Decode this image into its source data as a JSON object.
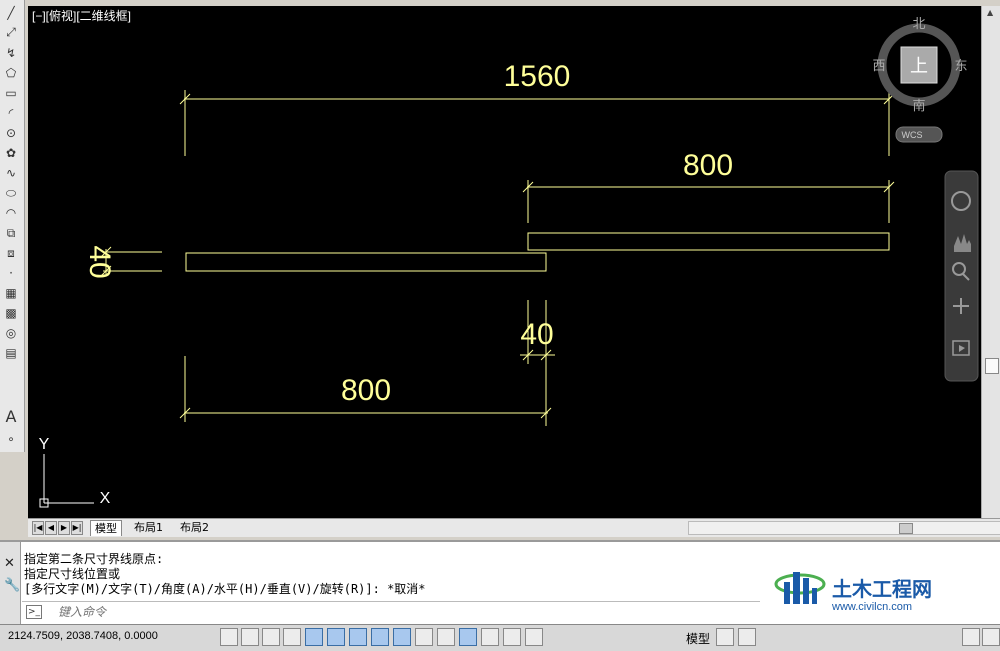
{
  "viewport": {
    "label": "[−][俯视][二维线框]",
    "background": "#000000",
    "line_color": "#ffff99"
  },
  "drawing": {
    "dim_top": "1560",
    "dim_upper": "800",
    "dim_left_vertical": "40",
    "dim_middle": "40",
    "dim_bottom": "800"
  },
  "ucs": {
    "y_label": "Y",
    "x_label": "X"
  },
  "viewcube": {
    "north": "北",
    "south": "南",
    "east": "东",
    "west": "西",
    "face": "上",
    "wcs": "WCS"
  },
  "tabs": [
    {
      "label": "模型",
      "active": true
    },
    {
      "label": "布局1",
      "active": false
    },
    {
      "label": "布局2",
      "active": false
    }
  ],
  "command": {
    "history": [
      "指定第二条尺寸界线原点:",
      "指定尺寸线位置或",
      "[多行文字(M)/文字(T)/角度(A)/水平(H)/垂直(V)/旋转(R)]: *取消*"
    ],
    "placeholder": "键入命令"
  },
  "status": {
    "coordinates": "2124.7509, 2038.7408, 0.0000",
    "model_label": "模型"
  },
  "watermark": {
    "title": "土木工程网",
    "url": "www.civilcn.com",
    "brand_blue": "#1a5aa8",
    "brand_green": "#4caf50"
  }
}
